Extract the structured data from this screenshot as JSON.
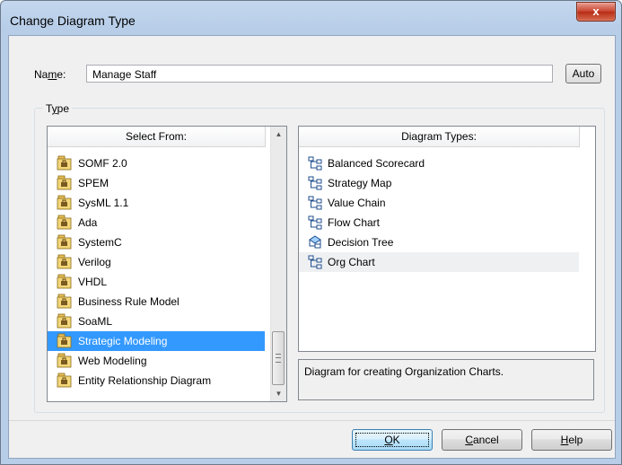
{
  "window": {
    "title": "Change Diagram Type",
    "close_label": "x"
  },
  "name_field": {
    "label_prefix": "Na",
    "label_mnemonic": "m",
    "label_suffix": "e:",
    "value": "Manage Staff",
    "auto_label": "Auto"
  },
  "type_group": {
    "label_prefix": "T",
    "label_mnemonic": "y",
    "label_suffix": "pe"
  },
  "select_from": {
    "header": "Select From:",
    "items": [
      {
        "label": "SOMF 2.0",
        "icon": "package-icon"
      },
      {
        "label": "SPEM",
        "icon": "package-icon"
      },
      {
        "label": "SysML 1.1",
        "icon": "package-icon"
      },
      {
        "label": "Ada",
        "icon": "package-icon"
      },
      {
        "label": "SystemC",
        "icon": "package-icon"
      },
      {
        "label": "Verilog",
        "icon": "package-icon"
      },
      {
        "label": "VHDL",
        "icon": "package-icon"
      },
      {
        "label": "Business Rule Model",
        "icon": "package-icon"
      },
      {
        "label": "SoaML",
        "icon": "package-icon"
      },
      {
        "label": "Strategic Modeling",
        "icon": "package-icon"
      },
      {
        "label": "Web Modeling",
        "icon": "package-icon"
      },
      {
        "label": "Entity Relationship Diagram",
        "icon": "package-icon"
      }
    ],
    "selected": "Strategic Modeling"
  },
  "diagram_types": {
    "header": "Diagram Types:",
    "items": [
      {
        "label": "Balanced Scorecard",
        "icon": "org-diagram-icon"
      },
      {
        "label": "Strategy Map",
        "icon": "org-diagram-icon"
      },
      {
        "label": "Value Chain",
        "icon": "org-diagram-icon"
      },
      {
        "label": "Flow Chart",
        "icon": "org-diagram-icon"
      },
      {
        "label": "Decision Tree",
        "icon": "decision-tree-icon"
      },
      {
        "label": "Org Chart",
        "icon": "org-diagram-icon"
      }
    ],
    "selected": "Org Chart"
  },
  "description": "Diagram for creating Organization Charts.",
  "buttons": {
    "ok_mnemonic": "O",
    "ok_suffix": "K",
    "cancel_mnemonic": "C",
    "cancel_suffix": "ancel",
    "help_mnemonic": "H",
    "help_suffix": "elp"
  },
  "colors": {
    "selection": "#3399ff",
    "title_bar": "#c4d7ee",
    "close_button": "#c7402a"
  }
}
